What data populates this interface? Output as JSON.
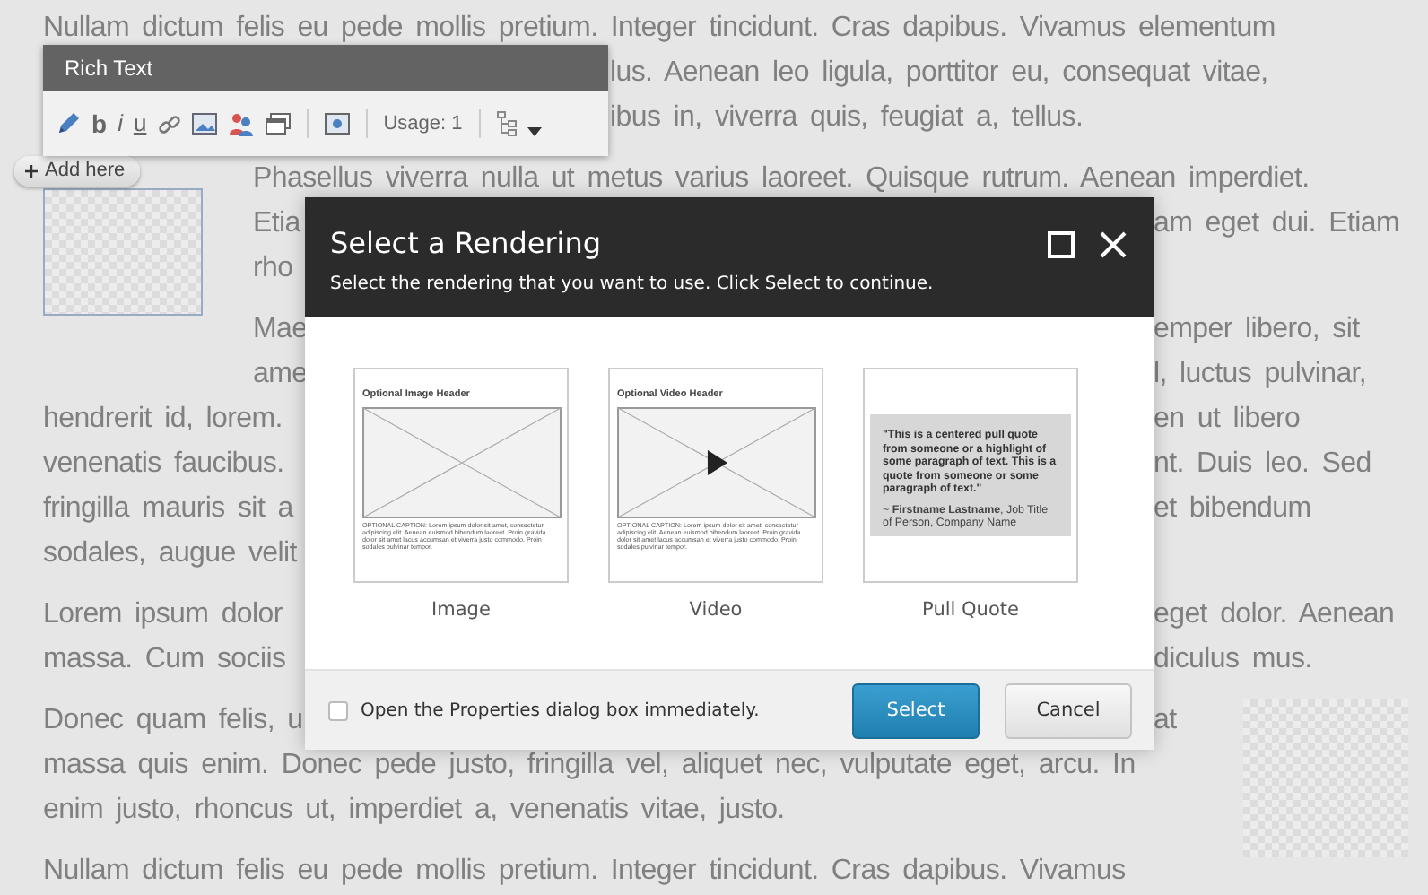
{
  "page": {
    "paragraphs": [
      {
        "lines": [
          {
            "left": "Nullam dictum felis eu pede mollis pretium. Integer tincidunt. Cras dapibus. Vivamus elementum"
          },
          {
            "right": "lus. Aenean leo ligula, porttitor eu, consequat vitae,"
          },
          {
            "right": "ibus in, viverra quis, feugiat a, tellus."
          }
        ]
      },
      {
        "lines": [
          {
            "left": "Phasellus viverra nulla ut metus varius laoreet. Quisque rutrum. Aenean imperdiet."
          },
          {
            "left": "Etia",
            "right": "am eget dui. Etiam"
          },
          {
            "left": "rho"
          }
        ]
      },
      {
        "lines": [
          {
            "left": "Mae",
            "right": "emper libero, sit"
          },
          {
            "left": "ame",
            "right": "l, luctus pulvinar,"
          },
          {
            "left": "hendrerit id, lorem.",
            "right": "en ut libero"
          },
          {
            "left": "venenatis faucibus.",
            "right": "nt. Duis leo. Sed"
          },
          {
            "left": "fringilla mauris sit a",
            "right": "et bibendum"
          },
          {
            "left": "sodales, augue velit"
          }
        ]
      },
      {
        "lines": [
          {
            "left": "Lorem ipsum dolor",
            "right": "eget dolor. Aenean"
          },
          {
            "left": "massa. Cum sociis",
            "right": "diculus mus."
          }
        ]
      },
      {
        "lines": [
          {
            "left": "Donec quam felis, u",
            "right": "at"
          },
          {
            "left": "massa quis enim. Donec pede justo, fringilla vel, aliquet nec, vulputate eget, arcu. In"
          },
          {
            "left": "enim justo, rhoncus ut, imperdiet a, venenatis vitae, justo."
          }
        ]
      },
      {
        "lines": [
          {
            "left": "Nullam dictum felis eu pede mollis pretium. Integer tincidunt. Cras dapibus. Vivamus"
          }
        ]
      }
    ],
    "add_here": "Add here"
  },
  "toolbar": {
    "title": "Rich Text",
    "format_buttons": [
      "b",
      "i",
      "u"
    ],
    "usage": "Usage: 1"
  },
  "dialog": {
    "title": "Select a Rendering",
    "subtitle": "Select the rendering that you want to use. Click Select to continue.",
    "renderings": [
      {
        "kind": "image",
        "label": "Image",
        "header": "Optional Image Header",
        "caption": "OPTIONAL CAPTION: Lorem ipsum dolor sit amet, consectetur adipiscing elit. Aenean euismod bibendum laoreet. Proin gravida dolor sit amet lacus accumsan et viverra justo commodo. Proin sodales pulvinar tempor."
      },
      {
        "kind": "video",
        "label": "Video",
        "header": "Optional Video Header",
        "caption": "OPTIONAL CAPTION: Lorem ipsum dolor sit amet, consectetur adipiscing elit. Aenean euismod bibendum laoreet. Proin gravida dolor sit amet lacus accumsan et viverra justo commodo. Proin sodales pulvinar tempor."
      },
      {
        "kind": "quote",
        "label": "Pull Quote",
        "quote": "\"This is a centered pull quote from someone or a highlight of some paragraph of text. This is a quote from someone or some paragraph of text.\"",
        "attribution": "~ **Firstname Lastname**, Job Title of Person, Company Name"
      }
    ],
    "checkbox": {
      "label": "Open the Properties dialog box immediately.",
      "checked": false
    },
    "buttons": [
      {
        "label": "Select",
        "primary": true
      },
      {
        "label": "Cancel",
        "primary": false
      }
    ]
  }
}
